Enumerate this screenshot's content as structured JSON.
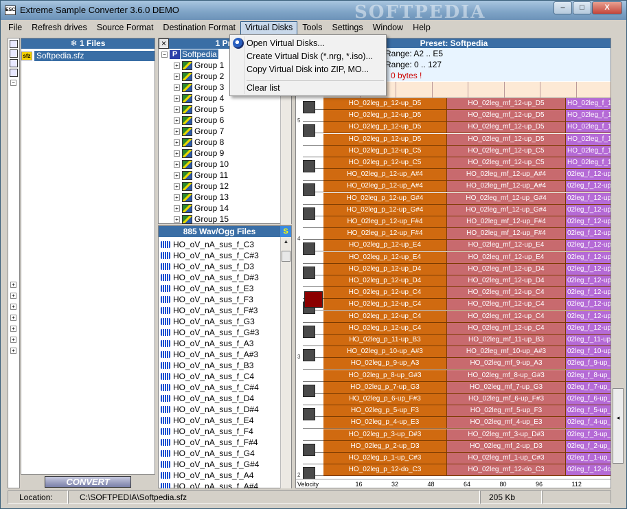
{
  "window": {
    "title": "Extreme Sample Converter 3.6.0 DEMO",
    "app_icon_text": "ESC",
    "watermark": "SOFTPEDIA",
    "close_label": "X",
    "min_label": "–",
    "max_label": "□"
  },
  "menu": [
    "File",
    "Refresh drives",
    "Source Format",
    "Destination Format",
    "Virtual Disks",
    "Tools",
    "Settings",
    "Window",
    "Help"
  ],
  "virtual_disks_menu": {
    "items": [
      "Open Virtual Disks...",
      "Create Virtual Disk (*.nrg, *.iso)...",
      "Copy Virtual Disk into ZIP, MO...",
      "Clear list"
    ]
  },
  "files_panel": {
    "header": "1 Files",
    "items": [
      {
        "icon": "sfz",
        "name": "Softpedia.sfz"
      }
    ]
  },
  "convert_button": "CONVERT",
  "presets_panel": {
    "header": "1 Prese",
    "root": "Softpedia",
    "groups": [
      "Group 1",
      "Group 2",
      "Group 3",
      "Group 4",
      "Group 5",
      "Group 6",
      "Group 7",
      "Group 8",
      "Group 9",
      "Group 10",
      "Group 11",
      "Group 12",
      "Group 13",
      "Group 14",
      "Group 15"
    ]
  },
  "wav_panel": {
    "header": "885 Wav/Ogg Files",
    "sort_button": "S",
    "items": [
      "HO_oV_nA_sus_f_C3",
      "HO_oV_nA_sus_f_C#3",
      "HO_oV_nA_sus_f_D3",
      "HO_oV_nA_sus_f_D#3",
      "HO_oV_nA_sus_f_E3",
      "HO_oV_nA_sus_f_F3",
      "HO_oV_nA_sus_f_F#3",
      "HO_oV_nA_sus_f_G3",
      "HO_oV_nA_sus_f_G#3",
      "HO_oV_nA_sus_f_A3",
      "HO_oV_nA_sus_f_A#3",
      "HO_oV_nA_sus_f_B3",
      "HO_oV_nA_sus_f_C4",
      "HO_oV_nA_sus_f_C#4",
      "HO_oV_nA_sus_f_D4",
      "HO_oV_nA_sus_f_D#4",
      "HO_oV_nA_sus_f_E4",
      "HO_oV_nA_sus_f_F4",
      "HO_oV_nA_sus_f_F#4",
      "HO_oV_nA_sus_f_G4",
      "HO_oV_nA_sus_f_G#4",
      "HO_oV_nA_sus_f_A4",
      "HO_oV_nA_sus_f_A#4"
    ]
  },
  "preset_view": {
    "header": "Preset: Softpedia",
    "key_range": "Range:  A2 .. E5",
    "vel_range": "Range:  0 .. 127",
    "size_text": "0 bytes !",
    "velocity_label": "Velocity",
    "velocity_ticks": [
      "16",
      "32",
      "48",
      "64",
      "80",
      "96",
      "112"
    ],
    "octave_labels": [
      "5",
      "4",
      "3",
      "2"
    ],
    "zones": [
      [
        "HO_02leg_p_12-up_D5",
        "HO_02leg_mf_12-up_D5",
        "HO_02leg_f_12-up_"
      ],
      [
        "HO_02leg_p_12-up_D5",
        "HO_02leg_mf_12-up_D5",
        "HO_02leg_f_12-up_"
      ],
      [
        "HO_02leg_p_12-up_D5",
        "HO_02leg_mf_12-up_D5",
        "HO_02leg_f_12-up_"
      ],
      [
        "HO_02leg_p_12-up_D5",
        "HO_02leg_mf_12-up_D5",
        "HO_02leg_f_12-up_"
      ],
      [
        "HO_02leg_p_12-up_C5",
        "HO_02leg_mf_12-up_C5",
        "HO_02leg_f_12-up_"
      ],
      [
        "HO_02leg_p_12-up_C5",
        "HO_02leg_mf_12-up_C5",
        "HO_02leg_f_12-up_"
      ],
      [
        "HO_02leg_p_12-up_A#4",
        "HO_02leg_mf_12-up_A#4",
        "02leg_f_12-up_"
      ],
      [
        "HO_02leg_p_12-up_A#4",
        "HO_02leg_mf_12-up_A#4",
        "02leg_f_12-up_"
      ],
      [
        "HO_02leg_p_12-up_G#4",
        "HO_02leg_mf_12-up_G#4",
        "02leg_f_12-up_"
      ],
      [
        "HO_02leg_p_12-up_G#4",
        "HO_02leg_mf_12-up_G#4",
        "02leg_f_12-up_"
      ],
      [
        "HO_02leg_p_12-up_F#4",
        "HO_02leg_mf_12-up_F#4",
        "02leg_f_12-up_"
      ],
      [
        "HO_02leg_p_12-up_F#4",
        "HO_02leg_mf_12-up_F#4",
        "02leg_f_12-up_"
      ],
      [
        "HO_02leg_p_12-up_E4",
        "HO_02leg_mf_12-up_E4",
        "02leg_f_12-up_"
      ],
      [
        "HO_02leg_p_12-up_E4",
        "HO_02leg_mf_12-up_E4",
        "02leg_f_12-up_"
      ],
      [
        "HO_02leg_p_12-up_D4",
        "HO_02leg_mf_12-up_D4",
        "02leg_f_12-up_"
      ],
      [
        "HO_02leg_p_12-up_D4",
        "HO_02leg_mf_12-up_D4",
        "02leg_f_12-up_"
      ],
      [
        "HO_02leg_p_12-up_C4",
        "HO_02leg_mf_12-up_C4",
        "02leg_f_12-up_"
      ],
      [
        "HO_02leg_p_12-up_C4",
        "HO_02leg_mf_12-up_C4",
        "02leg_f_12-up_"
      ],
      [
        "HO_02leg_p_12-up_C4",
        "HO_02leg_mf_12-up_C4",
        "02leg_f_12-up_"
      ],
      [
        "HO_02leg_p_12-up_C4",
        "HO_02leg_mf_12-up_C4",
        "02leg_f_12-up_"
      ],
      [
        "HO_02leg_p_11-up_B3",
        "HO_02leg_mf_11-up_B3",
        "02leg_f_11-up_"
      ],
      [
        "HO_02leg_p_10-up_A#3",
        "HO_02leg_mf_10-up_A#3",
        "02leg_f_10-up_"
      ],
      [
        "HO_02leg_p_9-up_A3",
        "HO_02leg_mf_9-up_A3",
        "02leg_f_9-up_"
      ],
      [
        "HO_02leg_p_8-up_G#3",
        "HO_02leg_mf_8-up_G#3",
        "02leg_f_8-up_G"
      ],
      [
        "HO_02leg_p_7-up_G3",
        "HO_02leg_mf_7-up_G3",
        "02leg_f_7-up_G"
      ],
      [
        "HO_02leg_p_6-up_F#3",
        "HO_02leg_mf_6-up_F#3",
        "02leg_f_6-up_F"
      ],
      [
        "HO_02leg_p_5-up_F3",
        "HO_02leg_mf_5-up_F3",
        "02leg_f_5-up_F"
      ],
      [
        "HO_02leg_p_4-up_E3",
        "HO_02leg_mf_4-up_E3",
        "02leg_f_4-up_"
      ],
      [
        "HO_02leg_p_3-up_D#3",
        "HO_02leg_mf_3-up_D#3",
        "02leg_f_3-up_"
      ],
      [
        "HO_02leg_p_2-up_D3",
        "HO_02leg_mf_2-up_D3",
        "02leg_f_2-up_"
      ],
      [
        "HO_02leg_p_1-up_C#3",
        "HO_02leg_mf_1-up_C#3",
        "02leg_f_1-up_"
      ],
      [
        "HO_02leg_p_12-do_C3",
        "HO_02leg_mf_12-do_C3",
        "02leg_f_12-do"
      ]
    ]
  },
  "status": {
    "location_label": "Location:",
    "path": "C:\\SOFTPEDIA\\Softpedia.sfz",
    "size": "205 Kb"
  }
}
